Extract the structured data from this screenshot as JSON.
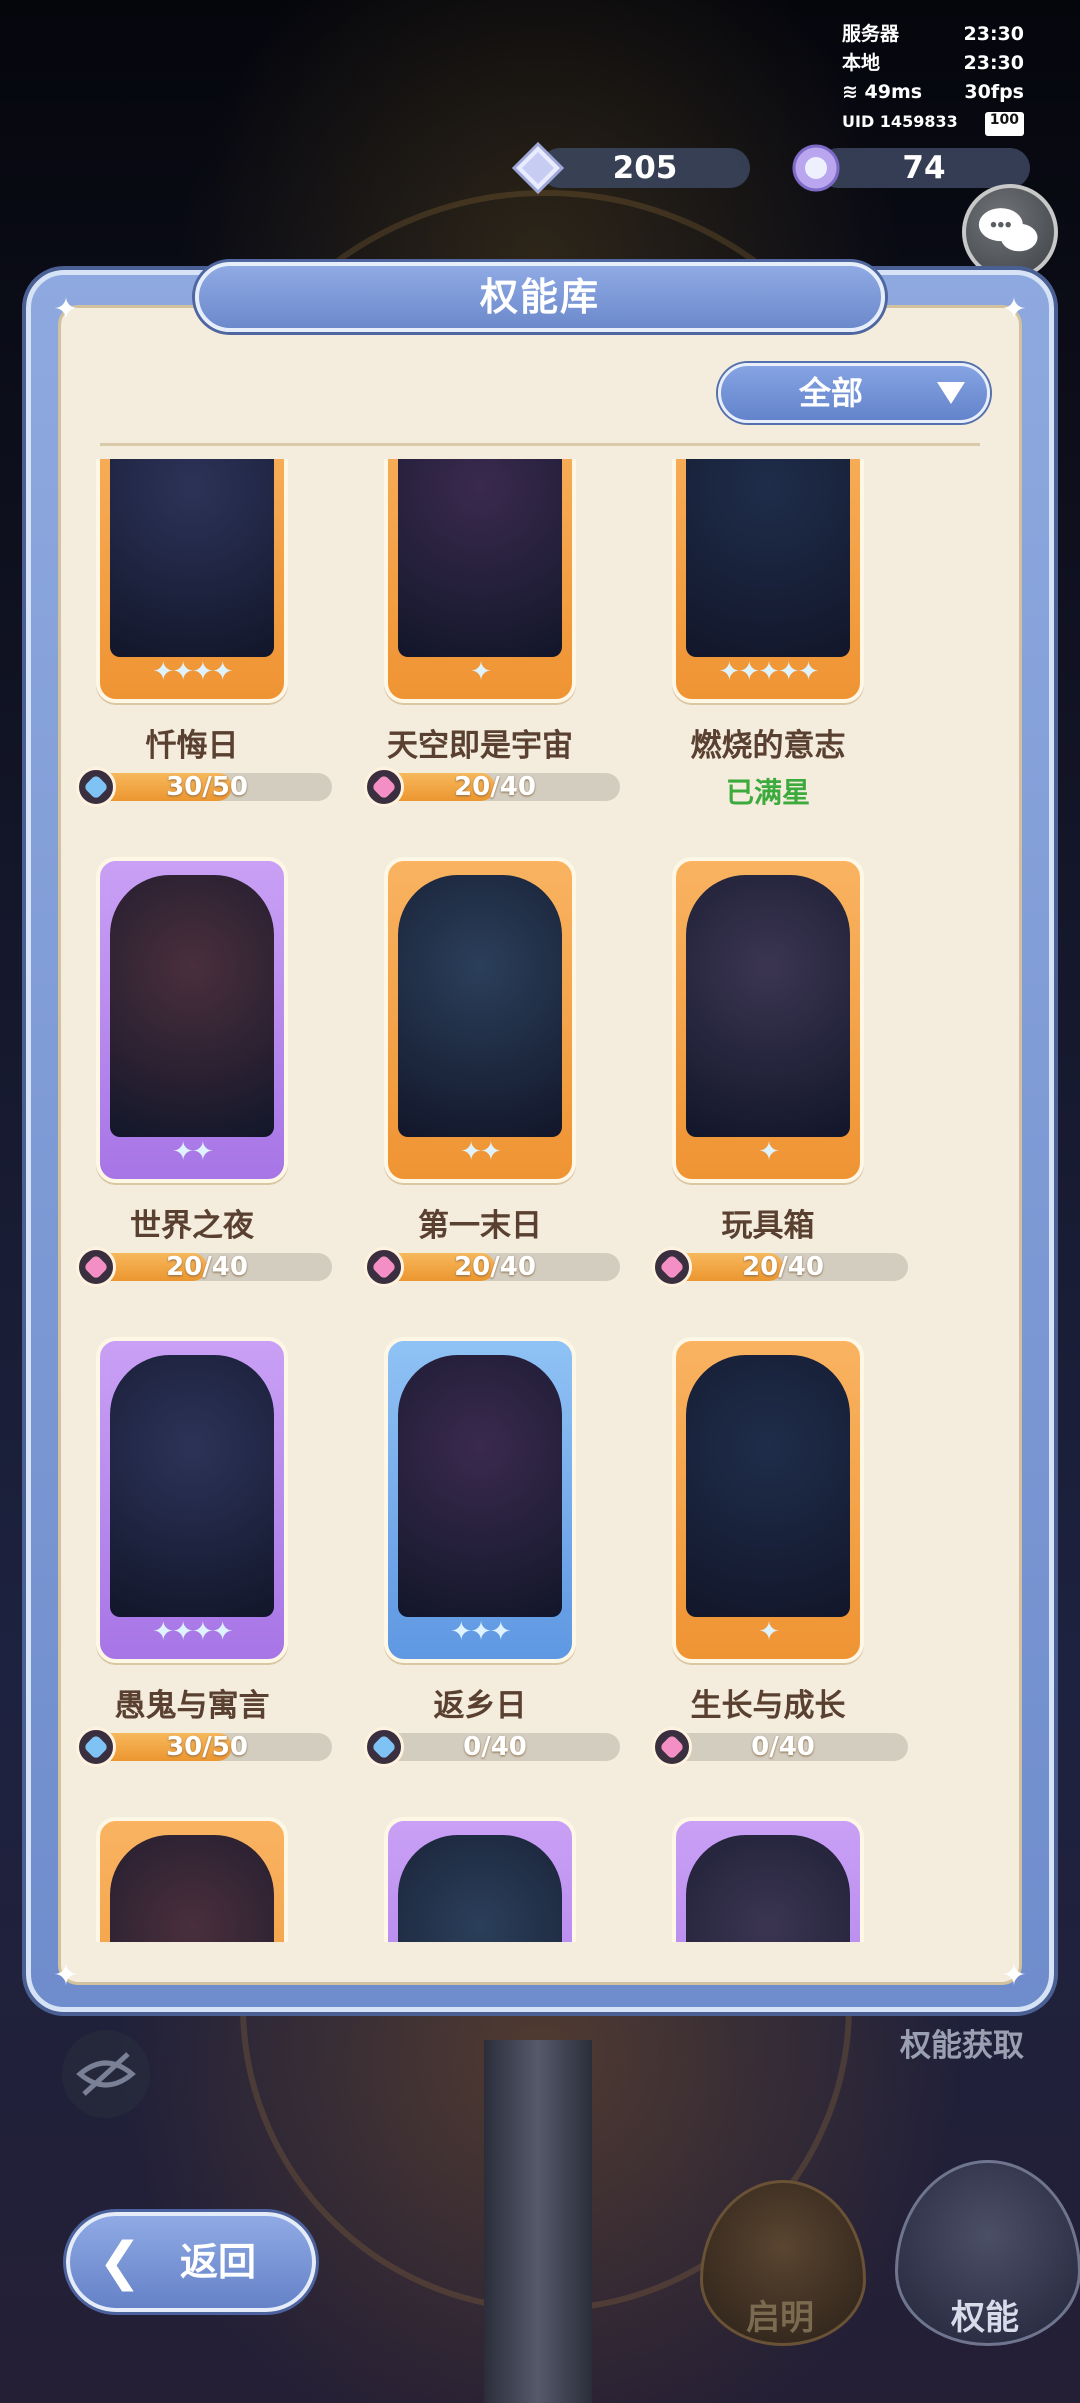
{
  "status": {
    "server_label": "服务器",
    "server_time": "23:30",
    "local_label": "本地",
    "local_time": "23:30",
    "ping": "49ms",
    "fps": "30fps",
    "uid": "UID 1459833",
    "battery": "100"
  },
  "currency": {
    "diamond": "205",
    "crystal": "74"
  },
  "panel": {
    "title": "权能库",
    "filter": "全部"
  },
  "cards": [
    {
      "name": "忏悔日",
      "progress": "30/50",
      "fill": 0.6,
      "frame": "orange",
      "pip": "blue",
      "stars": "✦✦✦✦"
    },
    {
      "name": "天空即是宇宙",
      "progress": "20/40",
      "fill": 0.5,
      "frame": "orange",
      "pip": "pink",
      "stars": "✦"
    },
    {
      "name": "燃烧的意志",
      "status": "已满星",
      "frame": "orange",
      "stars": "✦✦✦✦✦"
    },
    {
      "name": "世界之夜",
      "progress": "20/40",
      "fill": 0.5,
      "frame": "purple",
      "pip": "pink",
      "stars": "✦✦"
    },
    {
      "name": "第一末日",
      "progress": "20/40",
      "fill": 0.5,
      "frame": "orange",
      "pip": "pink",
      "stars": "✦✦"
    },
    {
      "name": "玩具箱",
      "progress": "20/40",
      "fill": 0.5,
      "frame": "orange",
      "pip": "pink",
      "stars": "✦"
    },
    {
      "name": "愚鬼与寓言",
      "progress": "30/50",
      "fill": 0.6,
      "frame": "purple",
      "pip": "blue",
      "stars": "✦✦✦✦"
    },
    {
      "name": "返乡日",
      "progress": "0/40",
      "fill": 0,
      "frame": "blue",
      "pip": "blue",
      "stars": "✦✦✦"
    },
    {
      "name": "生长与成长",
      "progress": "0/40",
      "fill": 0,
      "frame": "orange",
      "pip": "pink",
      "stars": "✦"
    },
    {
      "frame": "orange"
    },
    {
      "frame": "purple"
    },
    {
      "frame": "purple"
    }
  ],
  "bottom": {
    "acquire": "权能获取",
    "back": "返回",
    "nav_enlighten": "启明",
    "nav_power": "权能"
  },
  "colors": {
    "panel_blue": "#7393d3",
    "paper": "#f4ecdd",
    "progress_orange": "#ef9433",
    "maxed_green": "#3caa3c",
    "pip_blue": "#7fc3f5",
    "pip_pink": "#f48fc6"
  }
}
